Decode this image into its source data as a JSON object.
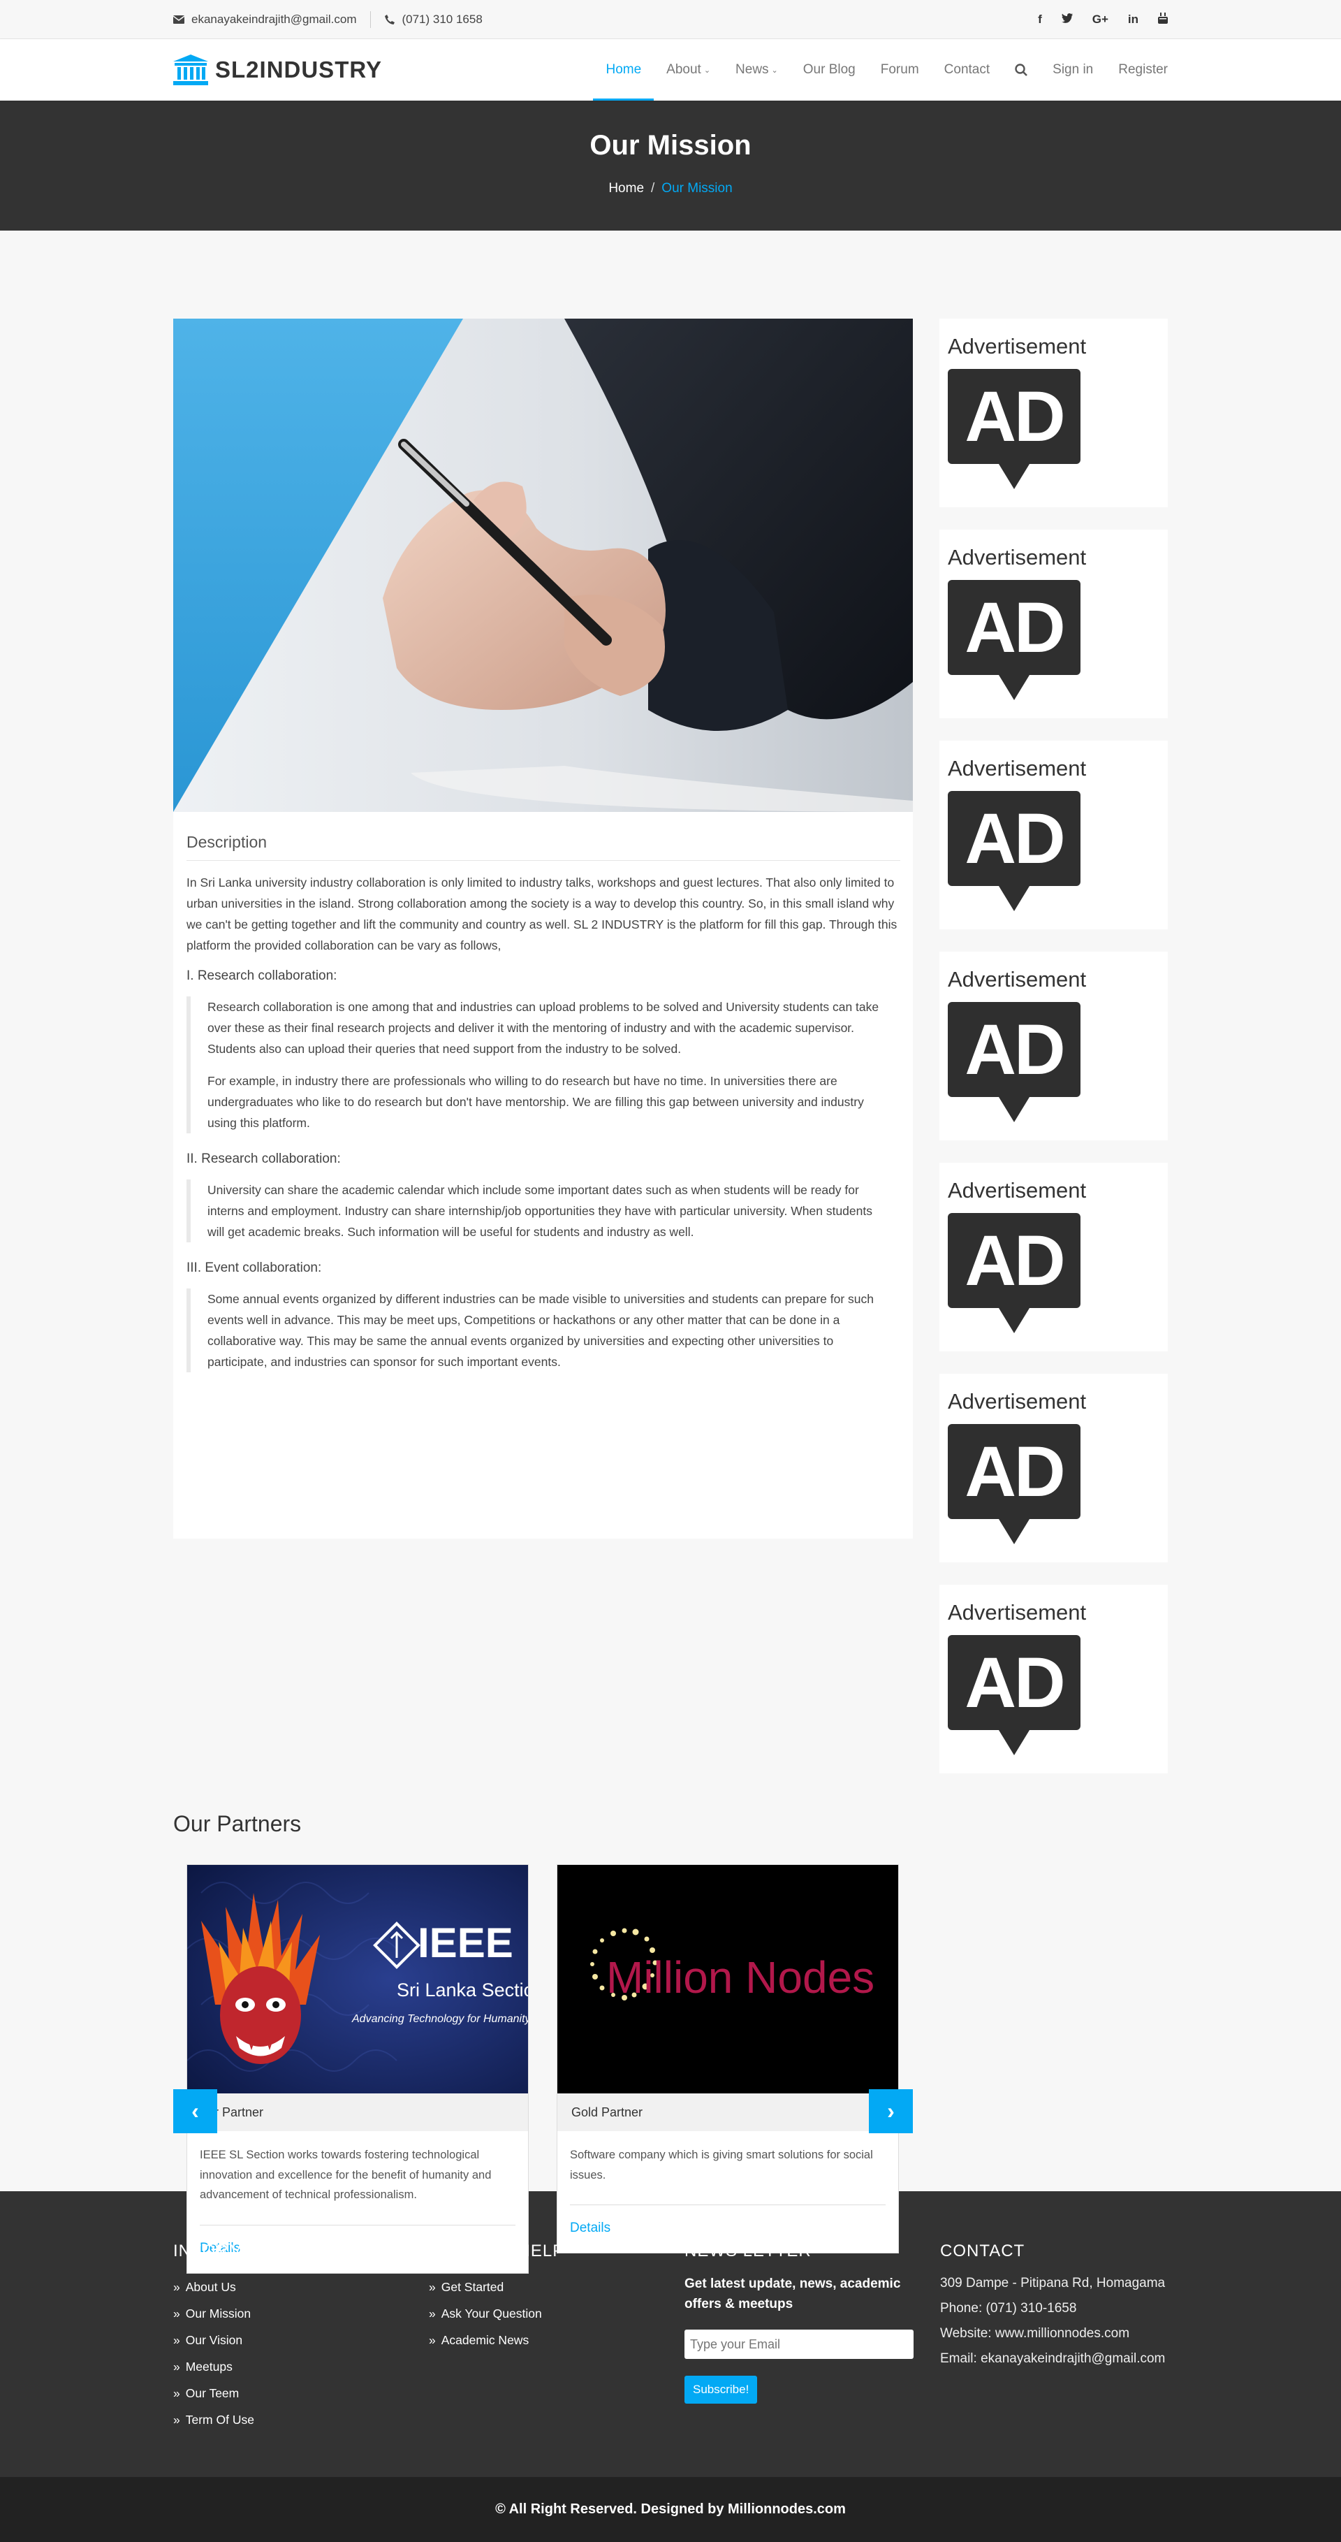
{
  "topbar": {
    "email": "ekanayakeindrajith@gmail.com",
    "phone": "(071) 310 1658",
    "social": [
      {
        "icon": "facebook-icon",
        "glyph": "f"
      },
      {
        "icon": "twitter-icon",
        "glyph": "🐦"
      },
      {
        "icon": "google-plus-icon",
        "glyph": "G+"
      },
      {
        "icon": "linkedin-icon",
        "glyph": "in"
      },
      {
        "icon": "youtube-icon",
        "glyph": "▶"
      }
    ]
  },
  "header": {
    "logo": "SL2INDUSTRY",
    "nav": {
      "home": "Home",
      "about": "About",
      "news": "News",
      "blog": "Our Blog",
      "forum": "Forum",
      "contact": "Contact",
      "signin": "Sign in",
      "register": "Register"
    }
  },
  "hero": {
    "title": "Our Mission",
    "crumb_home": "Home",
    "crumb_sep": "/",
    "crumb_current": "Our Mission"
  },
  "article": {
    "title": "Description",
    "intro": "In Sri Lanka university industry collaboration is only limited to industry talks, workshops and guest lectures. That also only limited to urban universities in the island. Strong collaboration among the society is a way to develop this country. So, in this small island why we can't be getting together and lift the community and country as well. SL 2 INDUSTRY is the platform for fill this gap. Through this platform the provided collaboration can be vary as follows,",
    "sec1_title": "I. Research collaboration:",
    "sec1_p1": "Research collaboration is one among that and industries can upload problems to be solved and University students can take over these as their final research projects and deliver it with the mentoring of industry and with the academic supervisor. Students also can upload their queries that need support from the industry to be solved.",
    "sec1_p2": "For example, in industry there are professionals who willing to do research but have no time. In universities there are undergraduates who like to do research but don't have mentorship. We are filling this gap between university and industry using this platform.",
    "sec2_title": "II. Research collaboration:",
    "sec2_p1": "University can share the academic calendar which include some important dates such as when students will be ready for interns and employment. Industry can share internship/job opportunities they have with particular university. When students will get academic breaks. Such information will be useful for students and industry as well.",
    "sec3_title": "III. Event collaboration:",
    "sec3_p1": "Some annual events organized by different industries can be made visible to universities and students can prepare for such events well in advance. This may be meet ups, Competitions or hackathons or any other matter that can be done in a collaborative way. This may be same the annual events organized by universities and expecting other universities to participate, and industries can sponsor for such important events."
  },
  "ads": {
    "title": "Advertisement",
    "badge": "AD"
  },
  "partners": {
    "title": "Our Partners",
    "cards": [
      {
        "logo_title": "IEEE",
        "logo_sub": "Sri Lanka Section",
        "logo_tag": "Advancing Technology for Humanity",
        "tier": "ver Partner",
        "text": "IEEE SL Section works towards fostering technological innovation and excellence for the benefit of humanity and advancement of technical professionalism.",
        "link": "Details"
      },
      {
        "logo_title": "Million Nodes",
        "tier": "Gold Partner",
        "text": "Software company which is giving smart solutions for social issues.",
        "link": "Details"
      }
    ]
  },
  "footer": {
    "info_title": "INFORMATION",
    "info_links": [
      "About Us",
      "Our Mission",
      "Our Vision",
      "Meetups",
      "Our Teem",
      "Term Of Use"
    ],
    "help_title": "STUDENT HELP",
    "help_links": [
      "Get Started",
      "Ask Your Question",
      "Academic News"
    ],
    "news_title": "NEWS LETTER",
    "news_text": "Get latest update, news, academic offers & meetups",
    "news_placeholder": "Type your Email",
    "news_button": "Subscribe!",
    "contact_title": "CONTACT",
    "address": "309 Dampe - Pitipana Rd, Homagama",
    "phone": "Phone: (071) 310-1658",
    "website": "Website: www.millionnodes.com",
    "email": "Email: ekanayakeindrajith@gmail.com",
    "copyright": "© All Right Reserved. Designed by Millionnodes.com"
  },
  "colors": {
    "accent": "#03a9f4",
    "dark": "#333333",
    "footer_bottom": "#222222"
  }
}
